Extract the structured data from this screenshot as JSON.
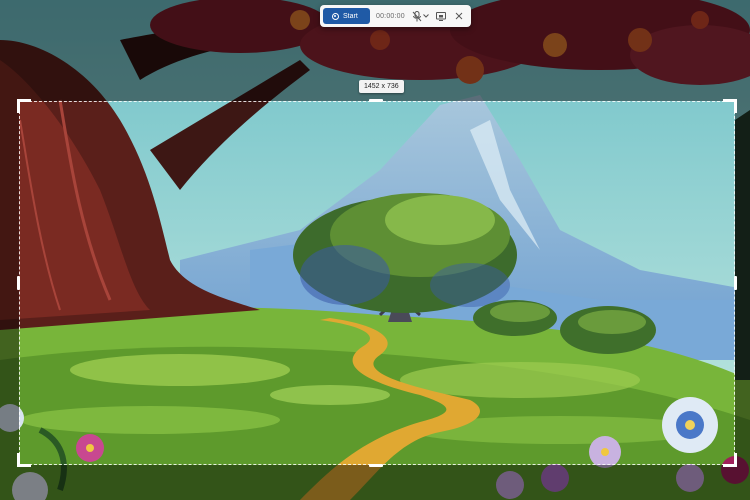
{
  "toolbar": {
    "start_label": "Start",
    "timer": "00:00:00",
    "icons": [
      "record-icon",
      "microphone-muted-icon",
      "chevron-down-icon",
      "screen-capture-icon",
      "close-icon"
    ]
  },
  "selection": {
    "dimensions_label": "1452 x 736"
  },
  "colors": {
    "accent": "#1f5aa6",
    "toolbar_bg": "#f7f7f7"
  }
}
